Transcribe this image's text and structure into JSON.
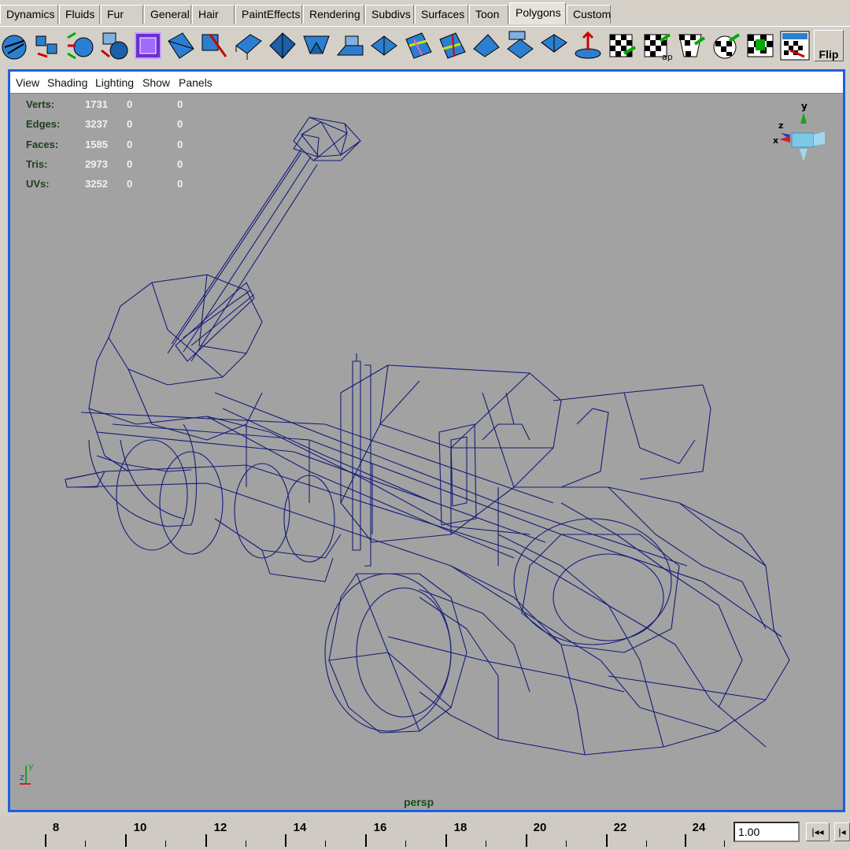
{
  "shelf_tabs": [
    "Dynamics",
    "Fluids",
    "Fur",
    "General",
    "Hair",
    "PaintEffects",
    "Rendering",
    "Subdivs",
    "Surfaces",
    "Toon",
    "Polygons",
    "Custom"
  ],
  "active_tab": "Polygons",
  "shelf_icons": [
    "poly-sphere-icon",
    "poly-cube-icon",
    "poly-cylinder-icon",
    "poly-cone-icon",
    "poly-plane-icon",
    "combine-icon",
    "separate-icon",
    "extract-icon",
    "smooth-icon",
    "bevel-icon",
    "extrude-face-icon",
    "extrude-edge-icon",
    "split-polygon-icon",
    "merge-vertices-icon",
    "append-polygon-icon",
    "cut-faces-icon",
    "subdivide-icon",
    "wedge-faces-icon",
    "duplicate-face-icon",
    "poke-faces-icon",
    "transform-component-icon",
    "planar-mapping-icon",
    "cylindrical-mapping-icon",
    "spherical-mapping-icon",
    "automatic-mapping-icon",
    "uv-texture-editor-icon",
    "layout-uvs-icon"
  ],
  "flip_label": "Flip",
  "panel_menu": [
    "View",
    "Shading",
    "Lighting",
    "Show",
    "Panels"
  ],
  "hud": {
    "rows": [
      {
        "label": "Verts:",
        "v1": "1731",
        "v2": "0",
        "v3": "0"
      },
      {
        "label": "Edges:",
        "v1": "3237",
        "v2": "0",
        "v3": "0"
      },
      {
        "label": "Faces:",
        "v1": "1585",
        "v2": "0",
        "v3": "0"
      },
      {
        "label": "Tris:",
        "v1": "2973",
        "v2": "0",
        "v3": "0"
      },
      {
        "label": "UVs:",
        "v1": "3252",
        "v2": "0",
        "v3": "0"
      }
    ]
  },
  "view_cube_axes": {
    "x": "x",
    "y": "y",
    "z": "z"
  },
  "camera_name": "persp",
  "timeline": {
    "ticks": [
      "8",
      "10",
      "12",
      "14",
      "16",
      "18",
      "20",
      "22",
      "24"
    ]
  },
  "current_time": "1.00",
  "playback_buttons": [
    "go-to-start-icon",
    "step-back-icon"
  ],
  "colors": {
    "accent": "#1d5fe0",
    "wire": "#141c78",
    "viewport_bg": "#a2a2a2",
    "hud_label": "#1d3f1d"
  }
}
